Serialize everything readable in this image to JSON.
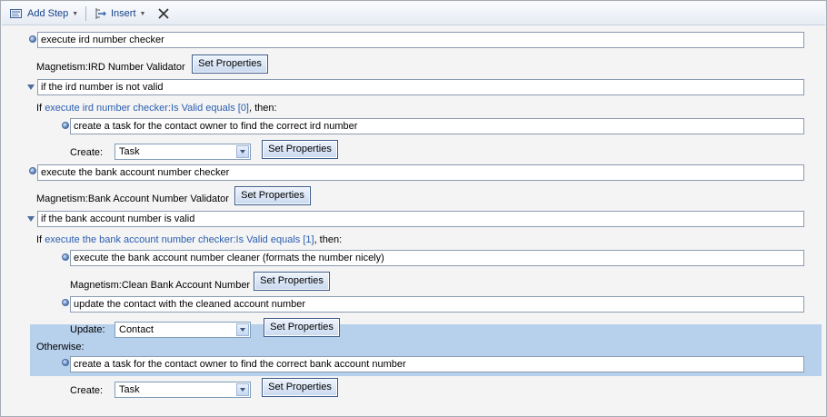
{
  "toolbar": {
    "add_step": "Add Step",
    "insert": "Insert"
  },
  "steps": {
    "s1": "execute ird number checker",
    "s1_meta_label": "Magnetism:IRD Number Validator",
    "set_properties": "Set Properties",
    "cond1": "if the ird number is not valid",
    "cond1_if": "If",
    "cond1_link": "execute ird number checker:Is Valid equals [0]",
    "cond1_then": ", then:",
    "s1a": "create a task for the contact owner to find the correct ird number",
    "create_label": "Create:",
    "create_value": "Task",
    "s2": "execute the bank account number checker",
    "s2_meta_label": "Magnetism:Bank Account Number Validator",
    "cond2": "if the bank account number is valid",
    "cond2_link": "execute the bank account number checker:Is Valid equals [1]",
    "s2a": "execute the bank account number cleaner (formats the number nicely)",
    "s2a_meta_label": "Magnetism:Clean Bank Account Number",
    "s2b": "update the contact with the cleaned account number",
    "update_label": "Update:",
    "update_value": "Contact",
    "otherwise": "Otherwise:",
    "s2c": "create a task for the contact owner to find the correct bank account number"
  }
}
